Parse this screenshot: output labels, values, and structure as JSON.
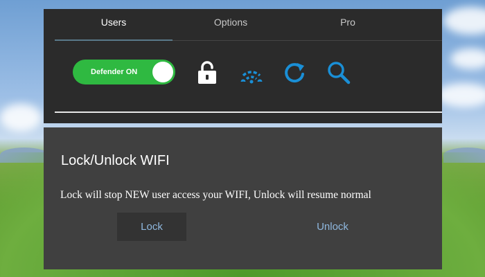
{
  "tabs": [
    {
      "label": "Users",
      "active": true
    },
    {
      "label": "Options",
      "active": false
    },
    {
      "label": "Pro",
      "active": false
    }
  ],
  "toolbar": {
    "defender_toggle": {
      "label": "Defender ON",
      "state": "on",
      "color": "#2fb941"
    },
    "icons": [
      "lock-open-icon",
      "wifi-icon",
      "refresh-icon",
      "search-icon"
    ],
    "icon_color": "#1a8fd6"
  },
  "dialog": {
    "title": "Lock/Unlock WIFI",
    "message": "Lock will stop NEW user access your WIFI, Unlock will resume normal",
    "lock_label": "Lock",
    "unlock_label": "Unlock"
  }
}
